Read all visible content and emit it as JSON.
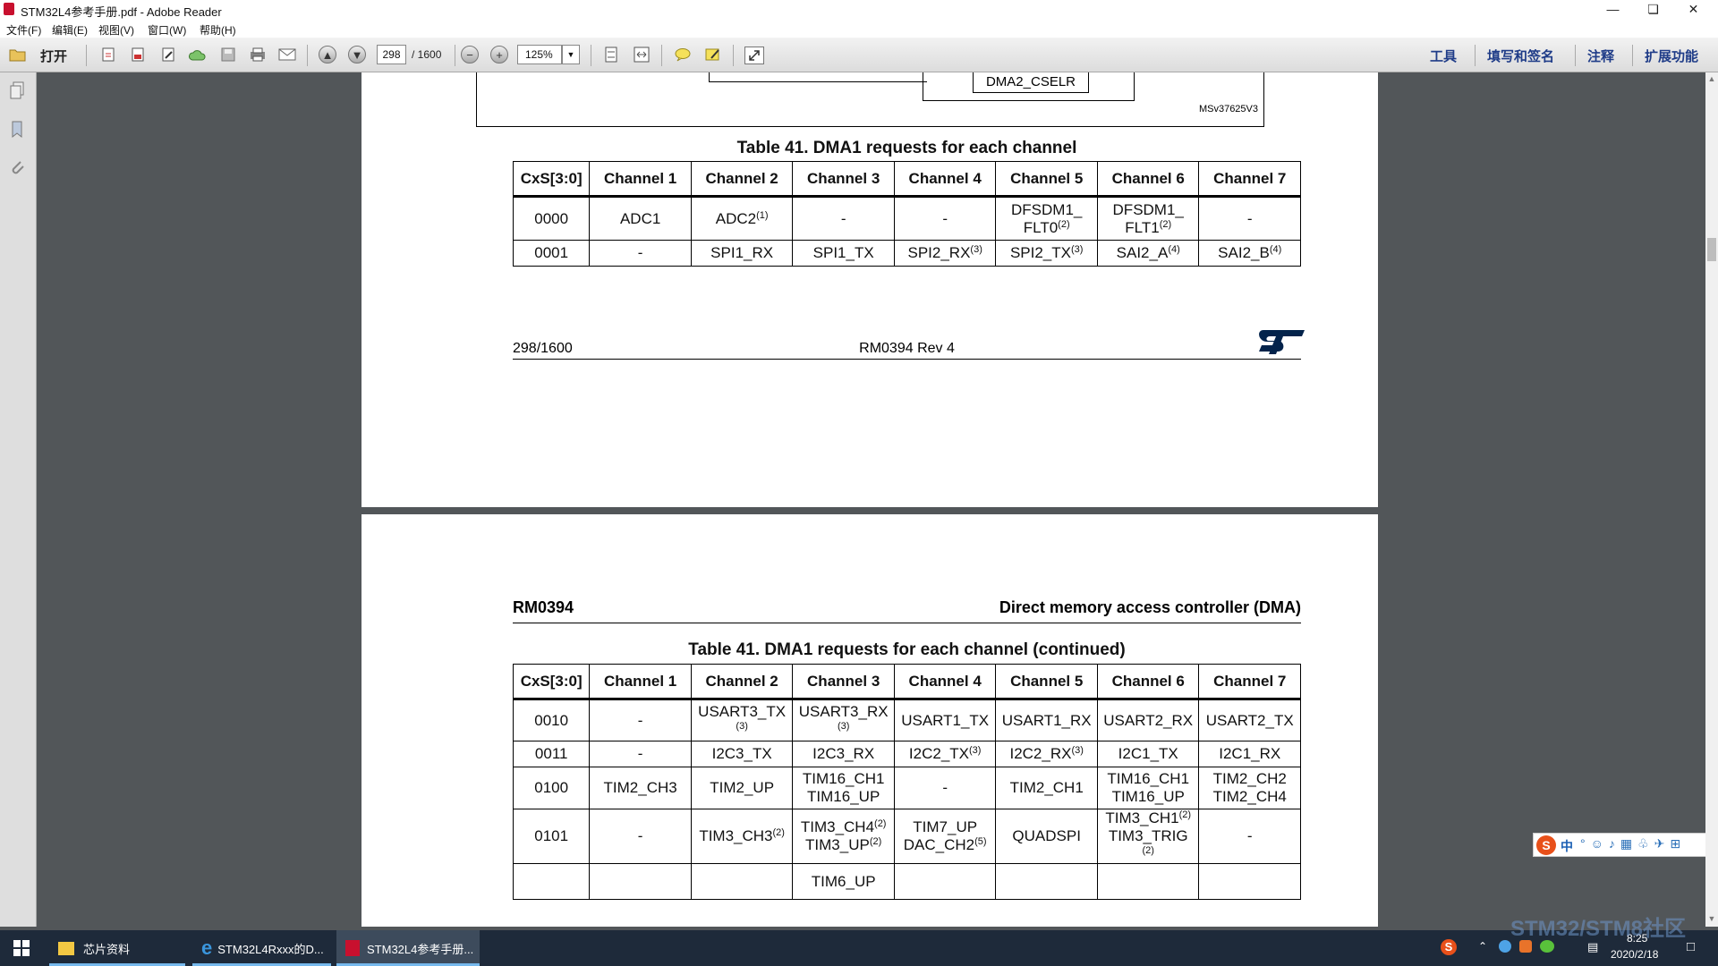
{
  "window": {
    "title": "STM32L4参考手册.pdf - Adobe Reader"
  },
  "menu": [
    "文件(F)",
    "编辑(E)",
    "视图(V)",
    "窗口(W)",
    "帮助(H)"
  ],
  "toolbar": {
    "open_label": "打开",
    "page_current": "298",
    "page_total": "/ 1600",
    "zoom": "125%",
    "right_links": [
      "工具",
      "填写和签名",
      "注释",
      "扩展功能"
    ]
  },
  "page1": {
    "diagram_box_label": "DMA2_CSELR",
    "diagram_id": "MSv37625V3",
    "caption": "Table 41. DMA1 requests for each channel",
    "footer_left": "298/1600",
    "footer_center": "RM0394 Rev 4",
    "logo_text": "ST"
  },
  "page2": {
    "header_left": "RM0394",
    "header_right": "Direct memory access controller (DMA)",
    "caption": "Table 41. DMA1 requests for each channel (continued)"
  },
  "table_headers": [
    "CxS[3:0]",
    "Channel 1",
    "Channel 2",
    "Channel 3",
    "Channel 4",
    "Channel 5",
    "Channel 6",
    "Channel 7"
  ],
  "table1_rows": [
    [
      "0000",
      "ADC1",
      "ADC2(1)",
      "-",
      "-",
      "DFSDM1_ FLT0(2)",
      "DFSDM1_ FLT1(2)",
      "-"
    ],
    [
      "0001",
      "-",
      "SPI1_RX",
      "SPI1_TX",
      "SPI2_RX(3)",
      "SPI2_TX(3)",
      "SAI2_A(4)",
      "SAI2_B(4)"
    ]
  ],
  "table2_rows": [
    [
      "0010",
      "-",
      "USART3_TX (3)",
      "USART3_RX (3)",
      "USART1_TX",
      "USART1_RX",
      "USART2_RX",
      "USART2_TX"
    ],
    [
      "0011",
      "-",
      "I2C3_TX",
      "I2C3_RX",
      "I2C2_TX(3)",
      "I2C2_RX(3)",
      "I2C1_TX",
      "I2C1_RX"
    ],
    [
      "0100",
      "TIM2_CH3",
      "TIM2_UP",
      "TIM16_CH1 TIM16_UP",
      "-",
      "TIM2_CH1",
      "TIM16_CH1 TIM16_UP",
      "TIM2_CH2 TIM2_CH4"
    ],
    [
      "0101",
      "-",
      "TIM3_CH3(2)",
      "TIM3_CH4(2) TIM3_UP(2)",
      "TIM7_UP DAC_CH2(5)",
      "QUADSPI",
      "TIM3_CH1(2) TIM3_TRIG (2)",
      "-"
    ],
    [
      "",
      "",
      "",
      "TIM6_UP",
      "",
      "",
      "",
      ""
    ]
  ],
  "taskbar": {
    "items": [
      "芯片资料",
      "STM32L4Rxxx的D...",
      "STM32L4参考手册..."
    ],
    "time": "8:25",
    "date": "2020/2/18"
  },
  "ime": {
    "label": "中"
  },
  "watermark": "STM32/STM8社区"
}
